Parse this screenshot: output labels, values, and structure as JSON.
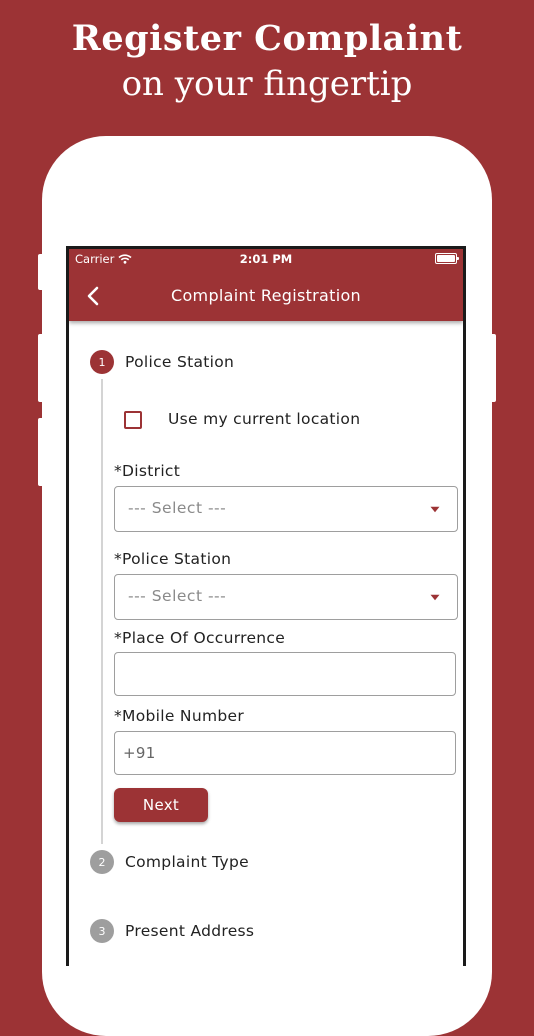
{
  "promo": {
    "title": "Register Complaint",
    "subtitle": "on your fingertip"
  },
  "status_bar": {
    "carrier": "Carrier",
    "time": "2:01 PM"
  },
  "appbar": {
    "title": "Complaint Registration"
  },
  "steps": [
    {
      "number": "1",
      "label": "Police Station",
      "active": true
    },
    {
      "number": "2",
      "label": "Complaint Type",
      "active": false
    },
    {
      "number": "3",
      "label": "Present Address",
      "active": false
    }
  ],
  "form": {
    "location_checkbox_label": "Use my current location",
    "location_checked": false,
    "district_label": "*District",
    "district_value": "--- Select ---",
    "police_station_label": "*Police Station",
    "police_station_value": "--- Select ---",
    "place_label": "*Place Of Occurrence",
    "place_value": "",
    "mobile_label": "*Mobile Number",
    "mobile_value": "+91",
    "next_button": "Next"
  },
  "colors": {
    "brand": "#9c3335",
    "inactive_step": "#9e9e9e"
  }
}
